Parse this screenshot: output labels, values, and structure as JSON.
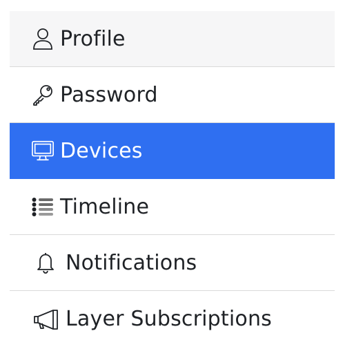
{
  "menu": {
    "items": [
      {
        "label": "Profile",
        "icon": "person-icon",
        "active": false
      },
      {
        "label": "Password",
        "icon": "key-icon",
        "active": false
      },
      {
        "label": "Devices",
        "icon": "monitor-icon",
        "active": true
      },
      {
        "label": "Timeline",
        "icon": "list-icon",
        "active": false
      },
      {
        "label": "Notifications",
        "icon": "bell-icon",
        "active": false
      },
      {
        "label": "Layer Subscriptions",
        "icon": "megaphone-icon",
        "active": false
      }
    ]
  },
  "colors": {
    "active_background": "#2f6ff1",
    "active_text": "#ffffff",
    "text": "#1f2226",
    "hover_background": "#f6f6f7",
    "divider": "#d9d9d9"
  }
}
